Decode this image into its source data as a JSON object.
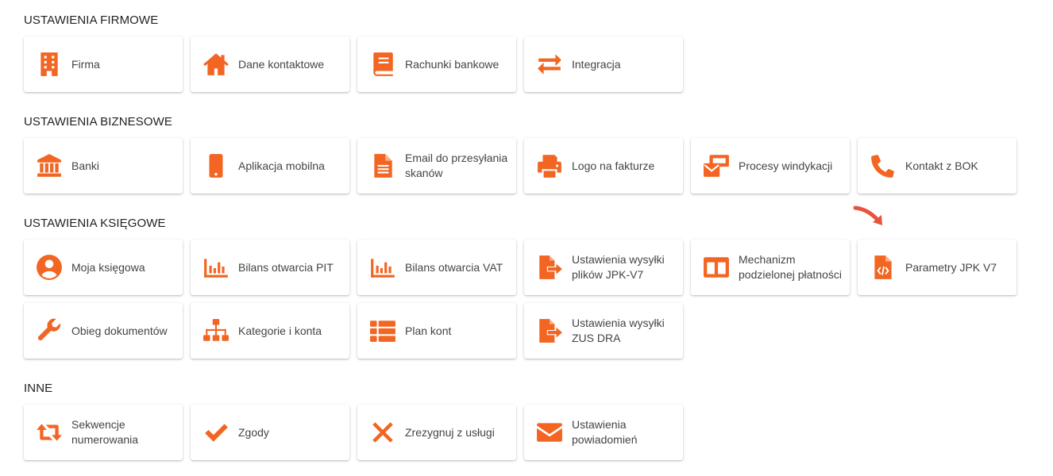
{
  "accent_color": "#f26522",
  "sections": [
    {
      "title": "USTAWIENIA FIRMOWE",
      "rows": [
        [
          {
            "label": "Firma",
            "icon": "building-icon"
          },
          {
            "label": "Dane kontaktowe",
            "icon": "home-icon"
          },
          {
            "label": "Rachunki bankowe",
            "icon": "book-icon"
          },
          {
            "label": "Integracja",
            "icon": "exchange-arrows-icon"
          }
        ]
      ]
    },
    {
      "title": "USTAWIENIA BIZNESOWE",
      "rows": [
        [
          {
            "label": "Banki",
            "icon": "bank-icon"
          },
          {
            "label": "Aplikacja mobilna",
            "icon": "mobile-icon"
          },
          {
            "label": "Email do przesyłania skanów",
            "icon": "document-icon"
          },
          {
            "label": "Logo na fakturze",
            "icon": "printer-icon"
          },
          {
            "label": "Procesy windykacji",
            "icon": "money-envelope-icon"
          },
          {
            "label": "Kontakt z BOK",
            "icon": "phone-icon"
          }
        ]
      ]
    },
    {
      "title": "USTAWIENIA KSIĘGOWE",
      "rows": [
        [
          {
            "label": "Moja księgowa",
            "icon": "user-circle-icon"
          },
          {
            "label": "Bilans otwarcia PIT",
            "icon": "bar-chart-icon"
          },
          {
            "label": "Bilans otwarcia VAT",
            "icon": "bar-chart-icon"
          },
          {
            "label": "Ustawienia wysyłki plików JPK-V7",
            "icon": "file-export-icon"
          },
          {
            "label": "Mechanizm podzielonej płatności",
            "icon": "columns-icon"
          },
          {
            "label": "Parametry JPK V7",
            "icon": "file-code-icon"
          }
        ],
        [
          {
            "label": "Obieg dokumentów",
            "icon": "wrench-icon"
          },
          {
            "label": "Kategorie i konta",
            "icon": "sitemap-icon"
          },
          {
            "label": "Plan kont",
            "icon": "list-icon"
          },
          {
            "label": "Ustawienia wysyłki ZUS DRA",
            "icon": "file-export-icon"
          }
        ]
      ]
    },
    {
      "title": "INNE",
      "rows": [
        [
          {
            "label": "Sekwencje numerowania",
            "icon": "retweet-icon"
          },
          {
            "label": "Zgody",
            "icon": "check-icon"
          },
          {
            "label": "Zrezygnuj z usługi",
            "icon": "close-icon"
          },
          {
            "label": "Ustawienia powiadomień",
            "icon": "envelope-icon"
          }
        ]
      ]
    }
  ],
  "annotation": {
    "icon": "pointer-arrow-icon",
    "color": "#e8533d"
  }
}
